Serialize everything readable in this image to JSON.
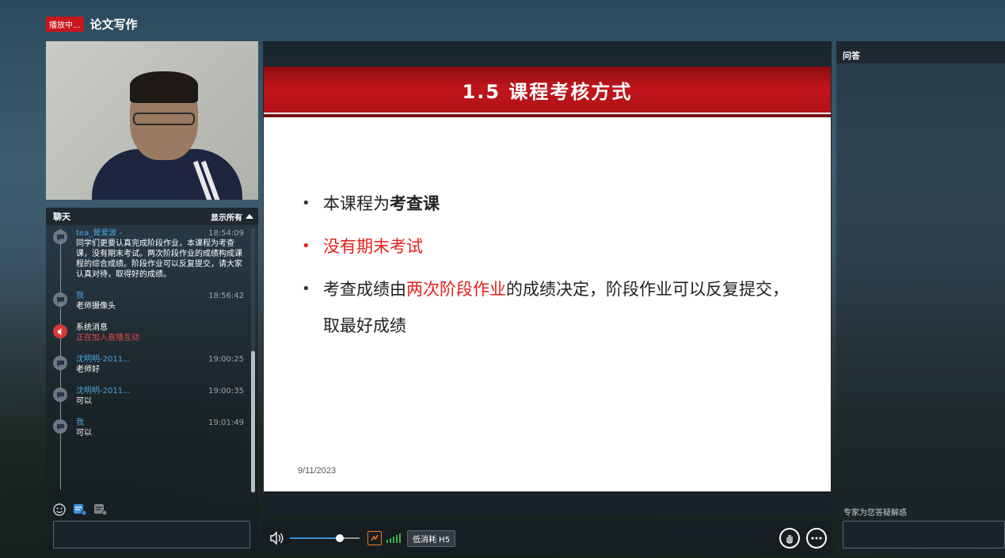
{
  "header": {
    "live_badge": "播放中...",
    "course_title": "论文写作"
  },
  "chat": {
    "title": "聊天",
    "show_all": "显示所有",
    "messages": [
      {
        "name": "tea_曾爱波 -",
        "time": "18:54:09",
        "text": "同学们更要认真完成阶段作业，本课程为考查课，没有期末考试。两次阶段作业的成绩构成课程的综合成绩。阶段作业可以反复提交，请大家认真对待，取得好的成绩。"
      },
      {
        "name": "我",
        "time": "18:56:42",
        "text": "老师摄像头"
      },
      {
        "name": "系统消息",
        "time": "",
        "text": "正在加入直播互动"
      },
      {
        "name": "沈明明-2011...",
        "time": "19:00:25",
        "text": "老师好"
      },
      {
        "name": "沈明明-2011...",
        "time": "19:00:35",
        "text": "可以"
      },
      {
        "name": "我",
        "time": "19:01:49",
        "text": "可以"
      }
    ],
    "input_placeholder": ""
  },
  "slide": {
    "title": "1.5 课程考核方式",
    "bullet1_a": "本课程为",
    "bullet1_b": "考查课",
    "bullet2": "没有期末考试",
    "bullet3_a": "考查成绩由",
    "bullet3_b": "两次阶段作业",
    "bullet3_c": "的成绩决定，阶段作业可以反复提交，取最好成绩",
    "date": "9/11/2023"
  },
  "player": {
    "volume_level": 0.72,
    "quality_label": "低消耗 H5"
  },
  "qa": {
    "title": "问答",
    "hint": "专家为您答疑解惑",
    "input_placeholder": ""
  },
  "colors": {
    "live_badge": "#c8161d",
    "slide_red": "#e3201b",
    "link_blue": "#4aa3df",
    "signal_green": "#3bb54a",
    "sync_orange": "#f07a1e"
  }
}
